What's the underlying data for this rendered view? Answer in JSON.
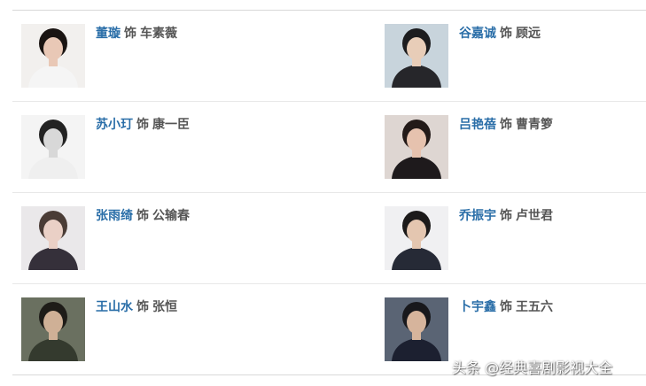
{
  "cast": [
    {
      "actor": "董璇",
      "shi": "饰",
      "role": "车素薇",
      "photo": {
        "bg": "#f2f0ee",
        "hair": "#1a1412",
        "skin": "#e9c8b6",
        "cloth": "#f5f5f5"
      }
    },
    {
      "actor": "谷嘉诚",
      "shi": "饰",
      "role": "顾远",
      "photo": {
        "bg": "#c8d4dc",
        "hair": "#1c1c1e",
        "skin": "#e8cdb8",
        "cloth": "#26262a"
      }
    },
    {
      "actor": "苏小玎",
      "shi": "饰",
      "role": "康一臣",
      "photo": {
        "bg": "#f4f4f4",
        "hair": "#222222",
        "skin": "#d8d8d8",
        "cloth": "#efefef"
      }
    },
    {
      "actor": "吕艳蓓",
      "shi": "饰",
      "role": "曹青箩",
      "photo": {
        "bg": "#ded6d2",
        "hair": "#231a18",
        "skin": "#e6c2ae",
        "cloth": "#1e1a1c"
      }
    },
    {
      "actor": "张雨绮",
      "shi": "饰",
      "role": "公输春",
      "photo": {
        "bg": "#eae8ea",
        "hair": "#4a3c36",
        "skin": "#ead0c6",
        "cloth": "#35303a"
      }
    },
    {
      "actor": "乔振宇",
      "shi": "饰",
      "role": "卢世君",
      "photo": {
        "bg": "#f0f0f2",
        "hair": "#1c1a1a",
        "skin": "#e4c6b0",
        "cloth": "#262a36"
      }
    },
    {
      "actor": "王山水",
      "shi": "饰",
      "role": "张恒",
      "photo": {
        "bg": "#6a7060",
        "hair": "#1e1c18",
        "skin": "#cfb096",
        "cloth": "#343a2e"
      }
    },
    {
      "actor": "卜宇鑫",
      "shi": "饰",
      "role": "王五六",
      "photo": {
        "bg": "#5a6474",
        "hair": "#18181c",
        "skin": "#d6b49c",
        "cloth": "#1c2030"
      }
    }
  ],
  "watermark": "头条 @经典喜剧影视大全",
  "colors": {
    "actor_link": "#2a6ea8",
    "text": "#555555",
    "divider": "#e8e8e8"
  }
}
